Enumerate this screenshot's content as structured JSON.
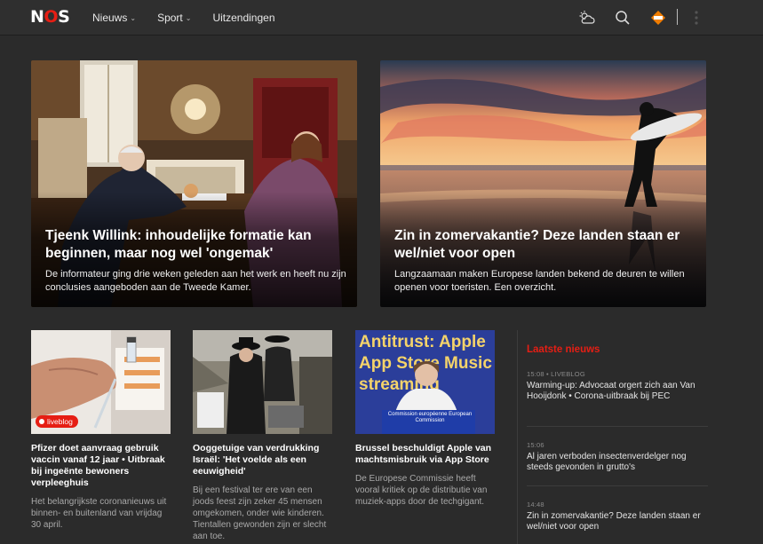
{
  "header": {
    "logo": "NOS",
    "nav": [
      {
        "label": "Nieuws",
        "has_dropdown": true
      },
      {
        "label": "Sport",
        "has_dropdown": true
      },
      {
        "label": "Uitzendingen",
        "has_dropdown": false
      }
    ],
    "icons": [
      "weather-icon",
      "search-icon",
      "npo-icon",
      "menu-icon"
    ]
  },
  "hero": [
    {
      "title": "Tjeenk Willink: inhoudelijke formatie kan beginnen, maar nog wel 'ongemak'",
      "subtitle": "De informateur ging drie weken geleden aan het werk en heeft nu zijn conclusies aangeboden aan de Tweede Kamer."
    },
    {
      "title": "Zin in zomervakantie? Deze landen staan er wel/niet voor open",
      "subtitle": "Langzaamaan maken Europese landen bekend de deuren te willen openen voor toeristen. Een overzicht."
    }
  ],
  "cards": [
    {
      "badge": "liveblog",
      "title": "Pfizer doet aanvraag gebruik vaccin vanaf 12 jaar • Uitbraak bij ingeënte bewoners verpleeghuis",
      "summary": "Het belangrijkste coronanieuws uit binnen- en buitenland van vrijdag 30 april."
    },
    {
      "badge": "",
      "title": "Ooggetuige van verdrukking Israël: 'Het voelde als een eeuwigheid'",
      "summary": "Bij een festival ter ere van een joods feest zijn zeker 45 mensen omgekomen, onder wie kinderen. Tientallen gewonden zijn er slecht aan toe."
    },
    {
      "badge": "",
      "thumb_text": "Antitrust: Apple App Store Music streaming",
      "podium_text": "Commission européenne European Commission",
      "title": "Brussel beschuldigt Apple van machtsmisbruik via App Store",
      "summary": "De Europese Commissie heeft vooral kritiek op de distributie van muziek-apps door de techgigant."
    }
  ],
  "latest": {
    "title": "Laatste nieuws",
    "items": [
      {
        "meta": "15:08 • LIVEBLOG",
        "headline": "Warming-up: Advocaat orgert zich aan Van Hooijdonk • Corona-uitbraak bij PEC"
      },
      {
        "meta": "15:06",
        "headline": "Al jaren verboden insectenverdelger nog steeds gevonden in grutto's"
      },
      {
        "meta": "14:48",
        "headline": "Zin in zomervakantie? Deze landen staan er wel/niet voor open"
      }
    ]
  },
  "colors": {
    "accent": "#e61e14",
    "background": "#2b2b2b",
    "header": "#2f2f2f"
  }
}
